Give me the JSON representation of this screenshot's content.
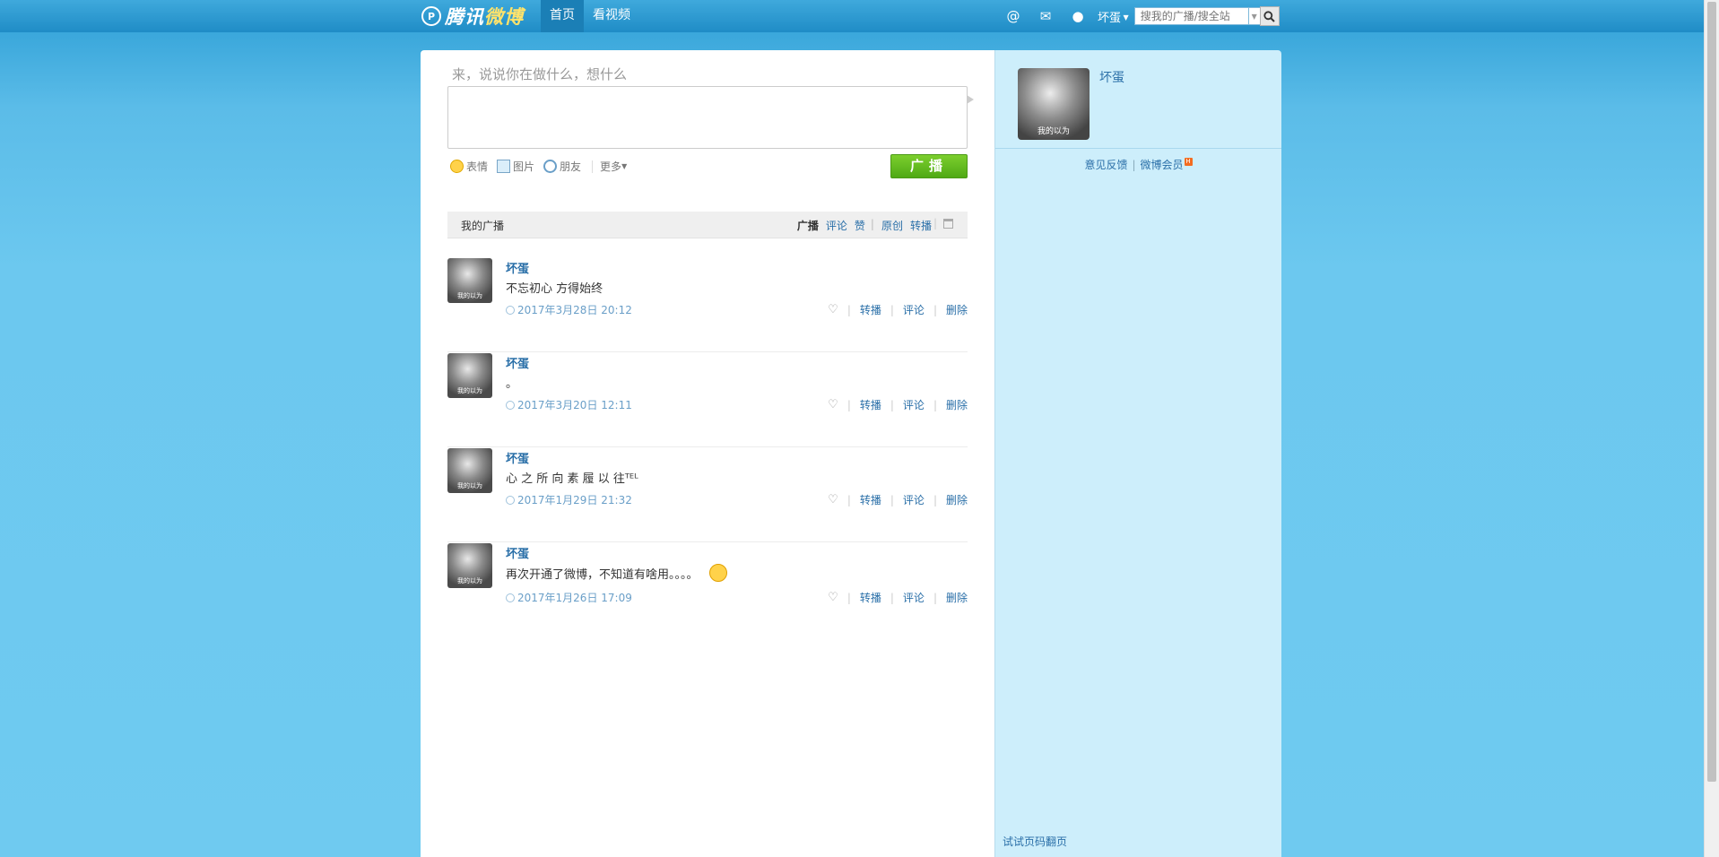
{
  "header": {
    "logo_text_a": "腾讯",
    "logo_text_b": "微博",
    "nav": [
      {
        "label": "首页"
      },
      {
        "label": "看视频"
      }
    ],
    "icons": [
      "at-icon",
      "mail-icon",
      "user-icon"
    ],
    "user_name": "坏蛋",
    "search_placeholder": "搜我的广播/搜全站"
  },
  "composer": {
    "prompt": "来，说说你在做什么，想什么",
    "tools": [
      {
        "label": "表情",
        "icon": "emoji-icon"
      },
      {
        "label": "图片",
        "icon": "image-icon"
      },
      {
        "label": "朋友",
        "icon": "at-friend-icon"
      }
    ],
    "more_label": "更多",
    "submit_label": "广播"
  },
  "feed": {
    "title": "我的广播",
    "filters": [
      "广播",
      "评论",
      "赞",
      "原创",
      "转播"
    ],
    "avatar_caption": "我的以为",
    "actions": {
      "repost": "转播",
      "comment": "评论",
      "delete": "删除"
    },
    "posts": [
      {
        "name": "坏蛋",
        "text": "不忘初心 方得始终",
        "time": "2017年3月28日 20:12"
      },
      {
        "name": "坏蛋",
        "text": "。",
        "time": "2017年3月20日 12:11"
      },
      {
        "name": "坏蛋",
        "text": "心 之 所 向 素 履 以 往ᵀᴱᴸ",
        "time": "2017年1月29日 21:32"
      },
      {
        "name": "坏蛋",
        "text": "再次开通了微博，不知道有啥用。。。。",
        "time": "2017年1月26日 17:09"
      }
    ]
  },
  "sidebar": {
    "name": "坏蛋",
    "avatar_caption": "我的以为",
    "feedback_label": "意见反馈",
    "vip_label": "微博会员",
    "vip_badge": "H",
    "bottom_link": "试试页码翻页"
  },
  "colors": {
    "brand_blue": "#2a6fa8",
    "button_green": "#5bb71d",
    "sidebar_bg": "#cdeefb"
  }
}
